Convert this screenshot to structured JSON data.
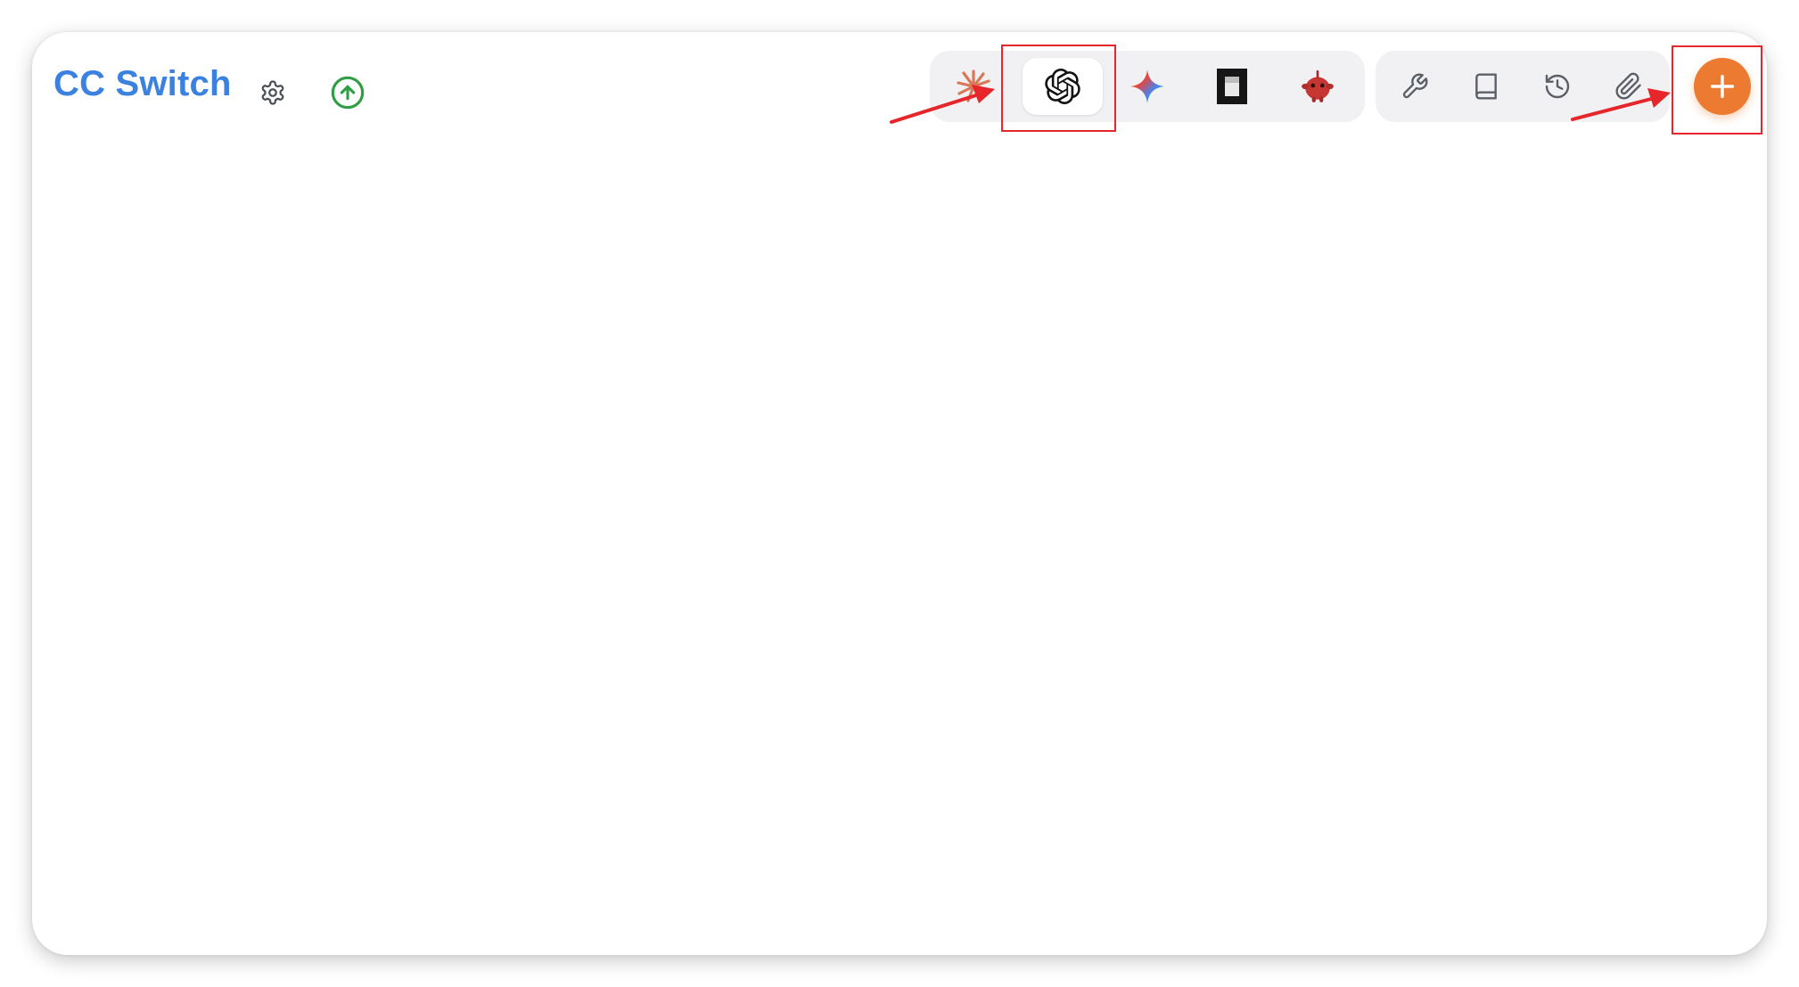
{
  "app": {
    "title": "CC Switch",
    "brand_color": "#3b82e0"
  },
  "header": {
    "settings_icon": "gear-icon",
    "update_icon": "arrow-up-circle-icon",
    "update_color": "#2f9e44"
  },
  "app_switcher": {
    "tabs": [
      {
        "name": "claude",
        "icon": "claude-starburst-icon",
        "active": false
      },
      {
        "name": "openai",
        "icon": "openai-logo-icon",
        "active": true
      },
      {
        "name": "gemini",
        "icon": "gemini-sparkle-icon",
        "active": false
      },
      {
        "name": "opencode",
        "icon": "opencode-square-icon",
        "active": false
      },
      {
        "name": "red-bot",
        "icon": "red-bot-icon",
        "active": false
      }
    ]
  },
  "tools": [
    {
      "name": "wrench",
      "icon": "wrench-icon"
    },
    {
      "name": "book",
      "icon": "book-icon"
    },
    {
      "name": "history",
      "icon": "history-icon"
    },
    {
      "name": "paperclip",
      "icon": "paperclip-icon"
    }
  ],
  "add_button": {
    "icon": "plus-icon",
    "color": "#ec7a30"
  },
  "annotations": {
    "highlight_color": "#e6262b"
  }
}
